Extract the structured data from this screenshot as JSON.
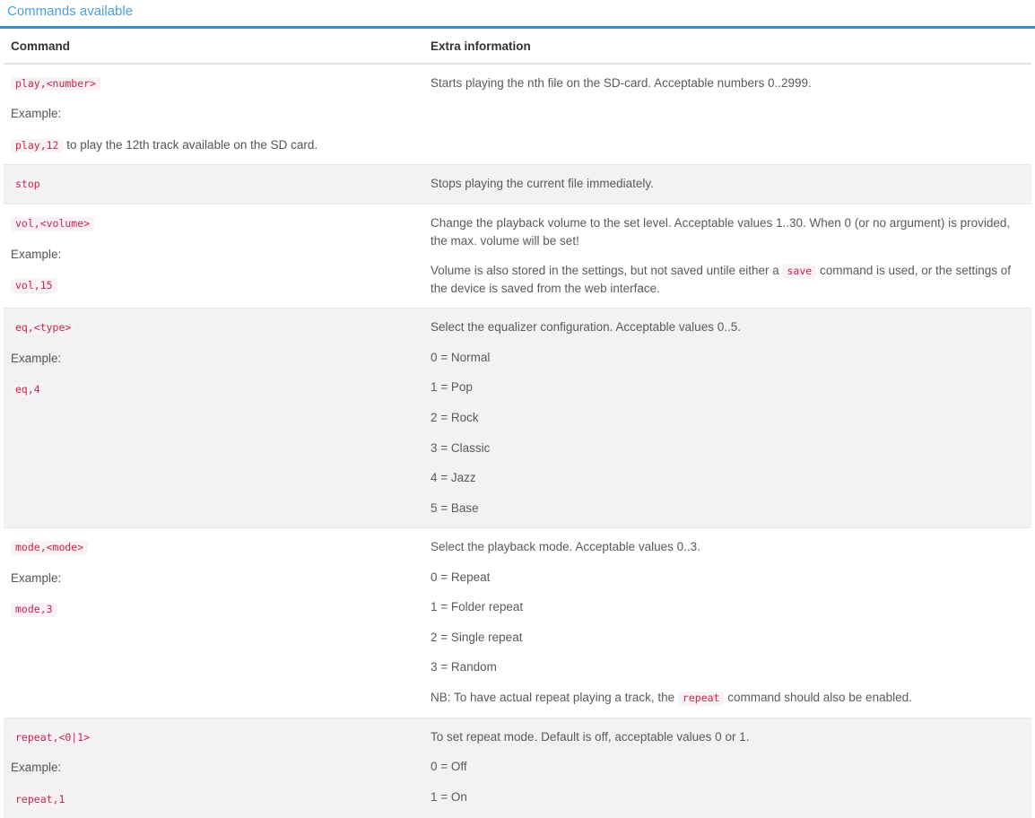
{
  "heading": {
    "title": "Commands available",
    "accent_color": "#2f8fdd",
    "title_color": "#4a9fe0"
  },
  "table": {
    "columns": [
      "Command",
      "Extra information"
    ],
    "code_color": "#c7254e",
    "code_background": "#f9f2f4",
    "stripe_color": "#f2f2f2",
    "rows": [
      {
        "syntax": "play,<number>",
        "example_label": "Example:",
        "example_code": "play,12",
        "example_suffix": " to play the 12th track available on the SD card.",
        "description": "Starts playing the nth file on the SD-card. Acceptable numbers 0..2999.",
        "options": [],
        "notes": [],
        "stripe": false
      },
      {
        "syntax": "stop",
        "example_label": "",
        "example_code": "",
        "example_suffix": "",
        "description": "Stops playing the current file immediately.",
        "options": [],
        "notes": [],
        "stripe": true
      },
      {
        "syntax": "vol,<volume>",
        "example_label": "Example:",
        "example_code": "vol,15",
        "example_suffix": "",
        "description": "Change the playback volume to the set level. Acceptable values 1..30. When 0 (or no argument) is provided, the max. volume will be set!",
        "options": [],
        "notes": [
          {
            "prefix": "Volume is also stored in the settings, but not saved untile either a ",
            "code": "save",
            "suffix": " command is used, or the settings of the device is saved from the web interface."
          }
        ],
        "stripe": false
      },
      {
        "syntax": "eq,<type>",
        "example_label": "Example:",
        "example_code": "eq,4",
        "example_suffix": "",
        "description": "Select the equalizer configuration. Acceptable values 0..5.",
        "options": [
          "0 = Normal",
          "1 = Pop",
          "2 = Rock",
          "3 = Classic",
          "4 = Jazz",
          "5 = Base"
        ],
        "notes": [],
        "stripe": true
      },
      {
        "syntax": "mode,<mode>",
        "example_label": "Example:",
        "example_code": "mode,3",
        "example_suffix": "",
        "description": "Select the playback mode. Acceptable values 0..3.",
        "options": [
          "0 = Repeat",
          "1 = Folder repeat",
          "2 = Single repeat",
          "3 = Random"
        ],
        "notes": [
          {
            "prefix": "NB: To have actual repeat playing a track, the ",
            "code": "repeat",
            "suffix": " command should also be enabled."
          }
        ],
        "stripe": false
      },
      {
        "syntax": "repeat,<0|1>",
        "example_label": "Example:",
        "example_code": "repeat,1",
        "example_suffix": "",
        "description": "To set repeat mode. Default is off, acceptable values 0 or 1.",
        "options": [
          "0 = Off",
          "1 = On"
        ],
        "notes": [],
        "stripe": true
      }
    ]
  }
}
